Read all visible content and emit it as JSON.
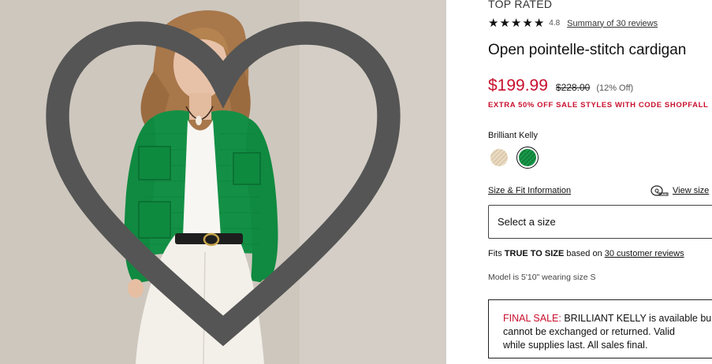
{
  "product": {
    "badge": "TOP RATED",
    "rating": "4.8",
    "reviews_link": "Summary of 30 reviews",
    "title": "Open pointelle-stitch cardigan",
    "price_sale": "$199.99",
    "price_original": "$228.00",
    "price_discount": "(12% Off)",
    "promo": "EXTRA 50% OFF SALE STYLES WITH CODE SHOPFALL",
    "color_name": "Brilliant Kelly",
    "swatches": [
      {
        "name": "beige",
        "color": "#e6d6bb"
      },
      {
        "name": "Brilliant Kelly",
        "color": "#16924a"
      }
    ],
    "fit_link": "Size & Fit Information",
    "view_size": "View size",
    "size_select_placeholder": "Select a size",
    "fit_note": {
      "prefix": "Fits ",
      "fit": "TRUE TO SIZE",
      "middle": " based on ",
      "link": "30 customer reviews"
    },
    "model_note": "Model is 5'10\" wearing size S",
    "final_sale": {
      "label": "FINAL SALE:",
      "line1": " BRILLIANT KELLY is available bu",
      "line2": "cannot be exchanged or returned. Valid",
      "line3": "while supplies last. All sales final."
    }
  },
  "colors": {
    "sale_red": "#c8102e",
    "cardigan_green": "#16924a"
  },
  "icons": {
    "wishlist": "heart-outline-icon",
    "star": "star-icon",
    "measure": "measuring-tape-icon"
  }
}
